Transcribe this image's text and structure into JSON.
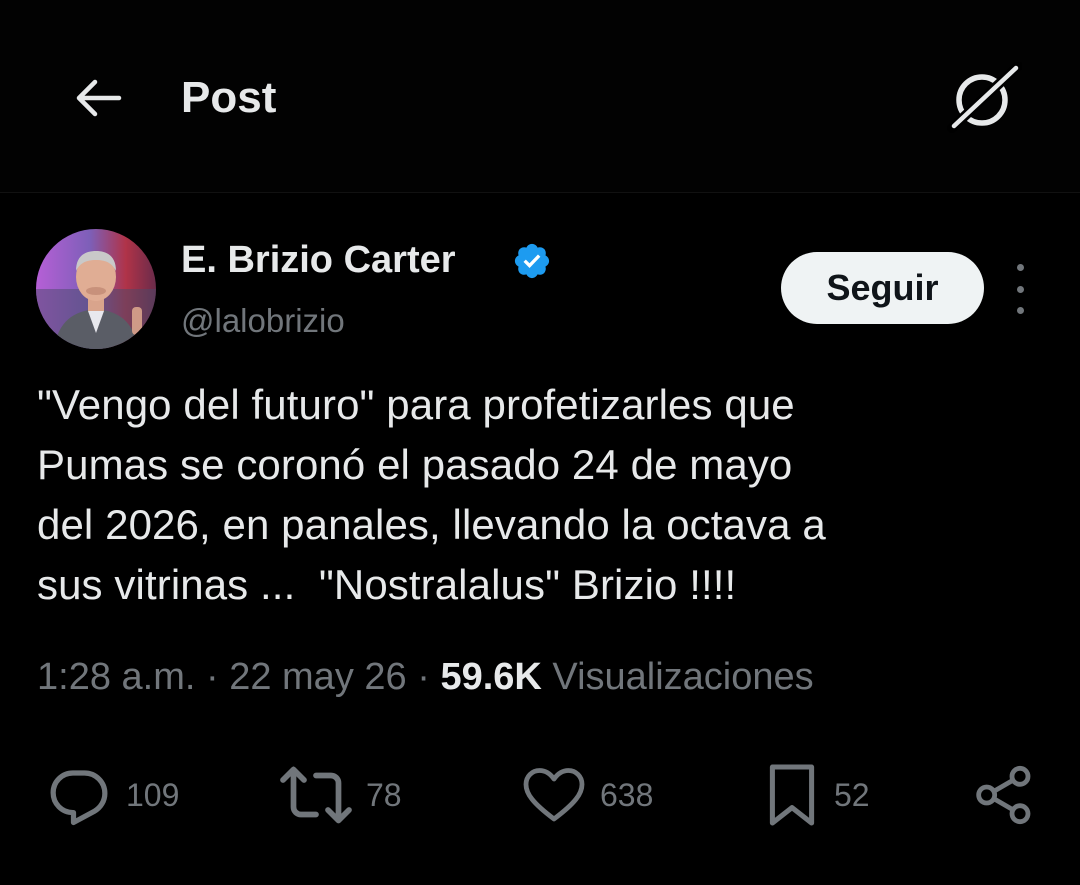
{
  "header": {
    "title": "Post",
    "back_icon": "arrow-left-icon",
    "grok_icon": "grok-icon"
  },
  "author": {
    "display_name": "E. Brizio Carter",
    "handle": "@lalobrizio",
    "verified": true,
    "verified_color": "#1d9bf0",
    "follow_label": "Seguir"
  },
  "tweet": {
    "text": "\"Vengo del futuro\" para profetizarles que\nPumas se coronó el pasado 24 de mayo\ndel 2026, en panales, llevando la octava a\nsus vitrinas ...  \"Nostralalus\" Brizio !!!!",
    "time": "1:28 a.m.",
    "date": "22 may 26",
    "views_count": "59.6K",
    "views_label": "Visualizaciones"
  },
  "actions": {
    "replies": "109",
    "reposts": "78",
    "likes": "638",
    "bookmarks": "52"
  },
  "colors": {
    "background": "#000000",
    "text": "#e7e9ea",
    "secondary": "#71767b",
    "follow_bg": "#eff3f4"
  }
}
